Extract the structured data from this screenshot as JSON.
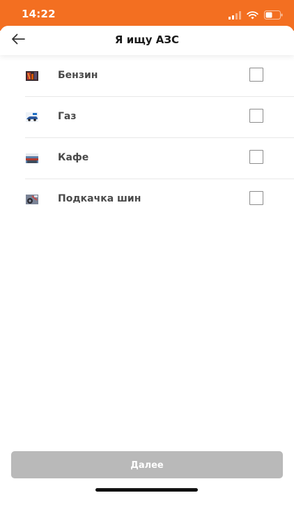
{
  "status_bar": {
    "time": "14:22",
    "background_color": "#f36f21"
  },
  "header": {
    "title": "Я ищу АЗС",
    "back_icon": "arrow-left-icon"
  },
  "options": [
    {
      "label": "Бензин",
      "icon": "fuel-pump-icon",
      "checked": false
    },
    {
      "label": "Газ",
      "icon": "gas-car-icon",
      "checked": false
    },
    {
      "label": "Кафе",
      "icon": "cafe-icon",
      "checked": false
    },
    {
      "label": "Подкачка шин",
      "icon": "tire-inflation-icon",
      "checked": false
    }
  ],
  "footer": {
    "next_label": "Далее",
    "next_enabled": false,
    "button_color": "#b9b9b9"
  }
}
